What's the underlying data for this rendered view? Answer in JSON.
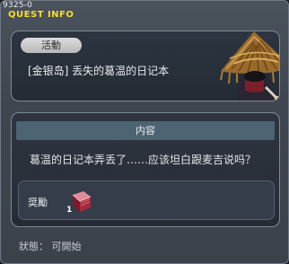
{
  "window": {
    "quest_id": "9325-0",
    "title": "QUEST INFO"
  },
  "quest": {
    "badge": "活動",
    "name": "[金银岛] 丢失的葛温的日记本"
  },
  "content": {
    "header": "内容",
    "description": "葛温的日记本弄丢了……应该坦白跟麦吉说吗？"
  },
  "reward": {
    "label": "奨勵",
    "item_icon": "red-book-icon",
    "quantity": "1"
  },
  "status": {
    "text": "狀態： 可開始"
  },
  "colors": {
    "title": "#f5dd2a",
    "header_bar": "#4d6472",
    "panel_border": "#7e8a98"
  }
}
